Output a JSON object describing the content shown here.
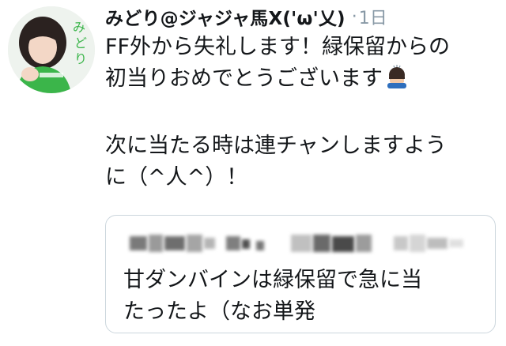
{
  "tweet": {
    "author": {
      "display_name": "みどり@ジャジャ馬X('ω'乂)",
      "avatar_text": "みどり"
    },
    "separator": "·",
    "timestamp": "1日",
    "text_lines": [
      "FF外から失礼します！緑保留からの",
      "初当りおめでとうございます",
      "",
      "次に当たる時は連チャンしますよう",
      "に（^人^）！"
    ],
    "emoji": "bowing-person-emoji",
    "quoted_tweet": {
      "header_obscured": true,
      "text_lines": [
        "甘ダンバインは緑保留で急に当",
        "たったよ（なお単発"
      ]
    }
  },
  "colors": {
    "text": "#14171a",
    "muted": "#8899a6",
    "border": "#ccd6dd",
    "avatar_green": "#3bb54a"
  }
}
